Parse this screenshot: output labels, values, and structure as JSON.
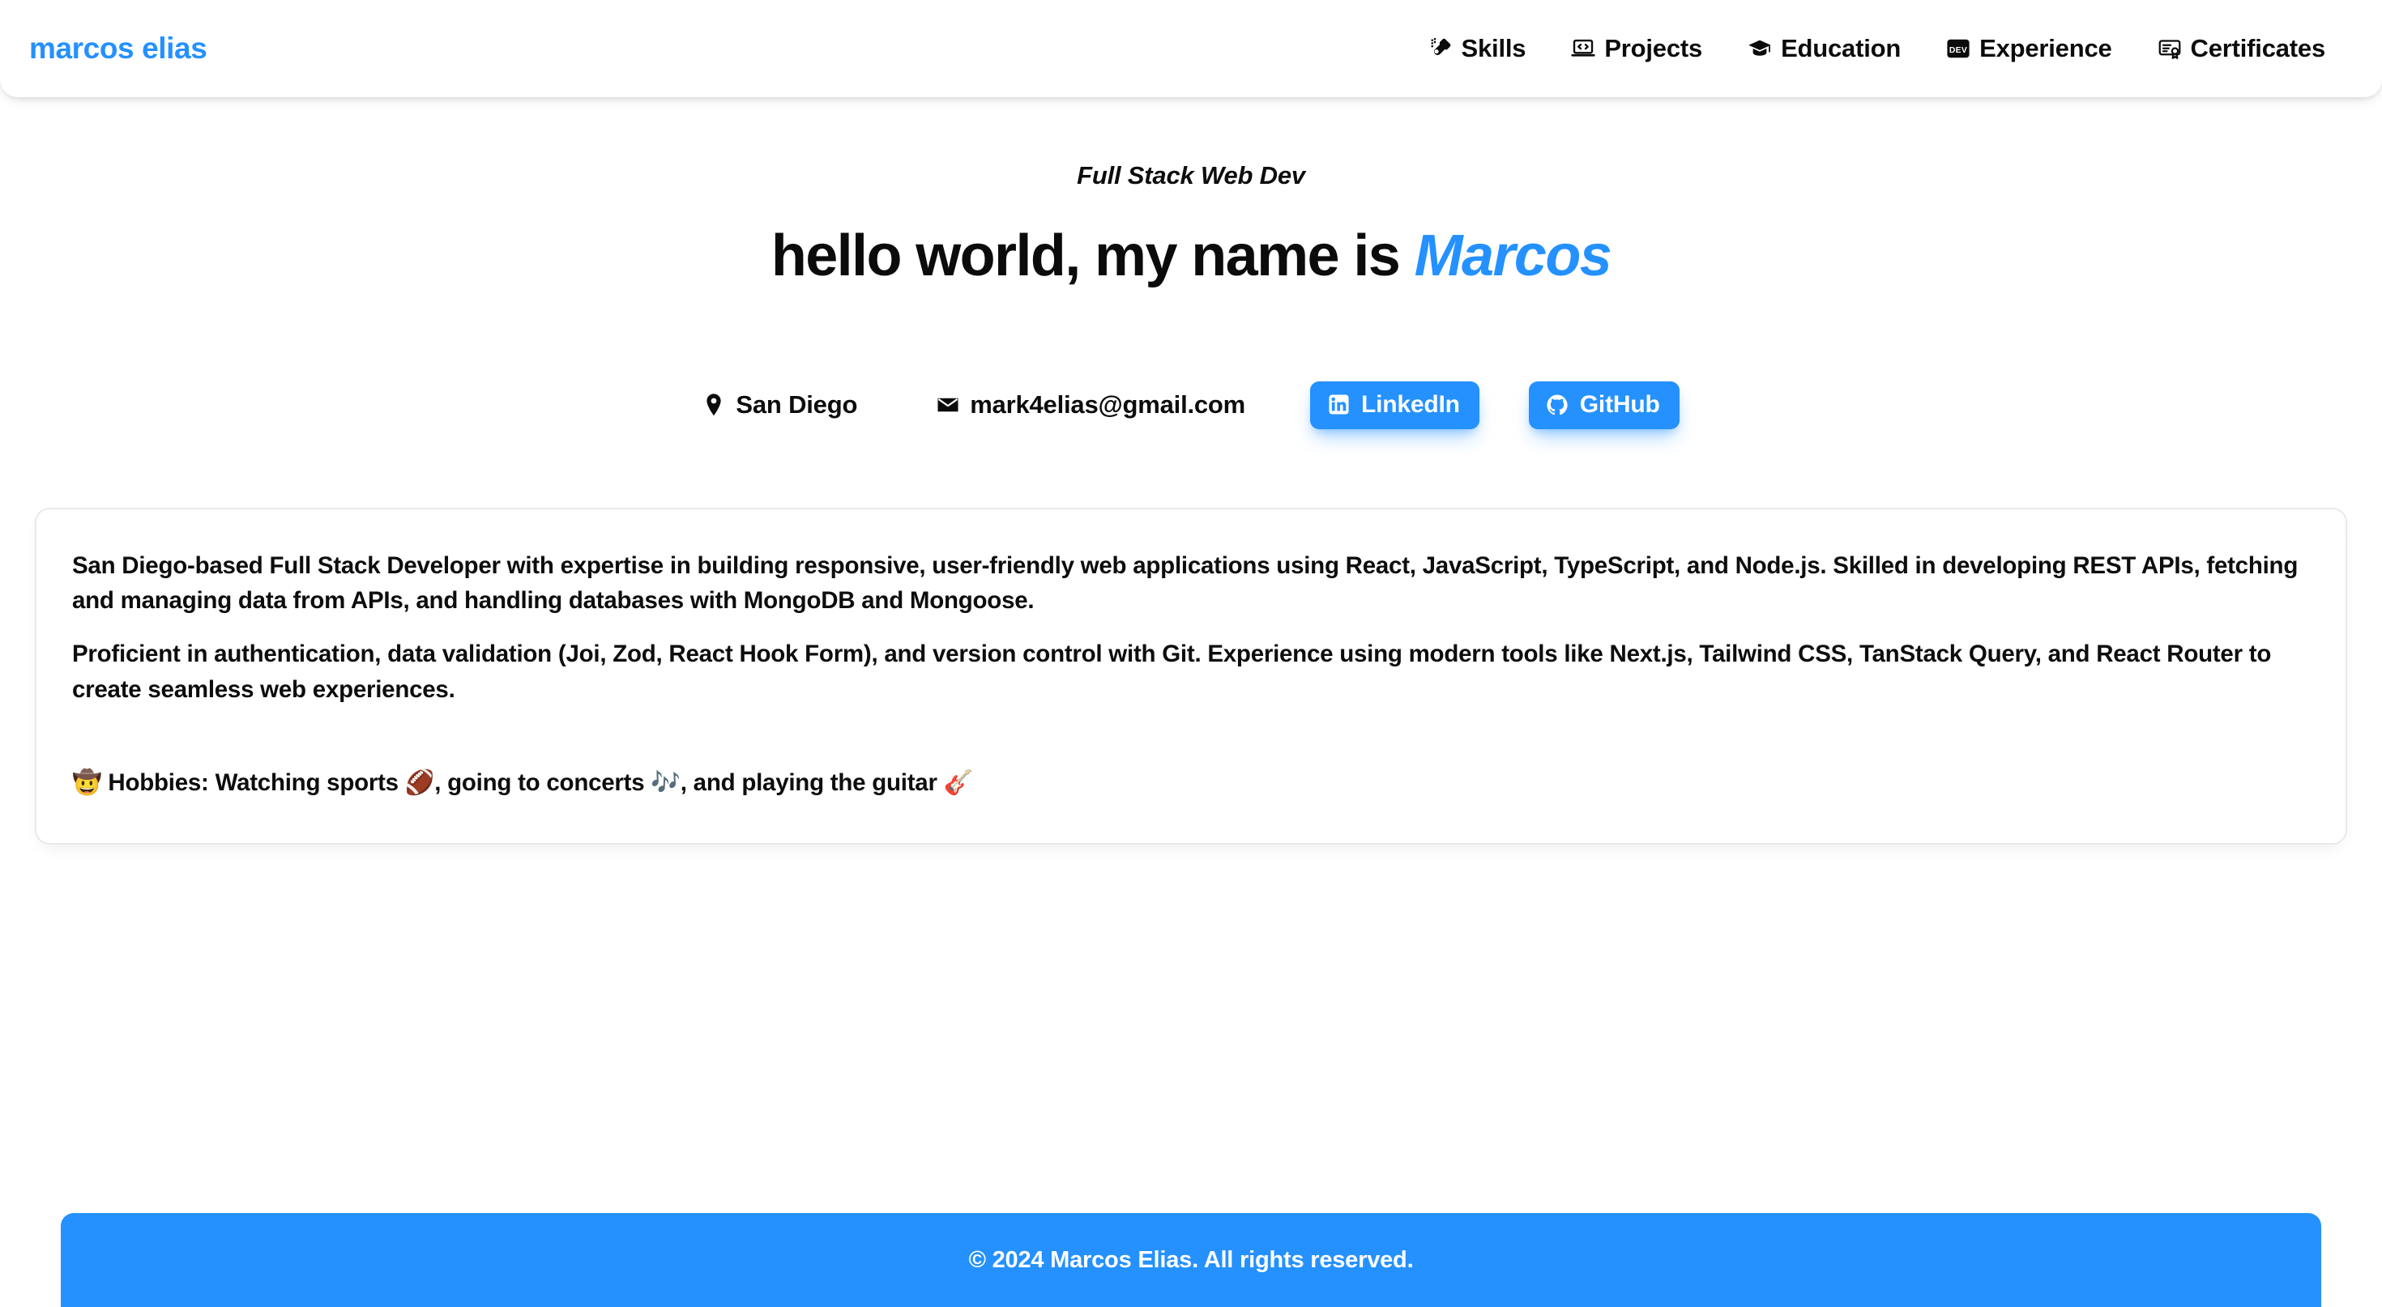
{
  "header": {
    "brand": "marcos elias",
    "nav": [
      {
        "label": "Skills",
        "icon": "guitar-icon"
      },
      {
        "label": "Projects",
        "icon": "code-laptop-icon"
      },
      {
        "label": "Education",
        "icon": "graduation-cap-icon"
      },
      {
        "label": "Experience",
        "icon": "dev-badge-icon"
      },
      {
        "label": "Certificates",
        "icon": "certificate-icon"
      }
    ]
  },
  "hero": {
    "tagline": "Full Stack Web Dev",
    "title_prefix": "hello world, my name is ",
    "title_accent": "Marcos"
  },
  "contact": {
    "location": {
      "text": "San Diego",
      "icon": "location-pin-icon"
    },
    "email": {
      "text": "mark4elias@gmail.com",
      "icon": "envelope-icon"
    },
    "socials": [
      {
        "label": "LinkedIn",
        "icon": "linkedin-icon"
      },
      {
        "label": "GitHub",
        "icon": "github-icon"
      }
    ]
  },
  "bio": {
    "paragraph1": "San Diego-based Full Stack Developer with expertise in building responsive, user-friendly web applications using React, JavaScript, TypeScript, and Node.js. Skilled in developing REST APIs, fetching and managing data from APIs, and handling databases with MongoDB and Mongoose.",
    "paragraph2": "Proficient in authentication, data validation (Joi, Zod, React Hook Form), and version control with Git. Experience using modern tools like Next.js, Tailwind CSS, TanStack Query, and React Router to create seamless web experiences.",
    "hobbies": "🤠 Hobbies: Watching sports 🏈, going to concerts 🎶, and playing the guitar 🎸"
  },
  "footer": {
    "copyright": "© 2024 Marcos Elias. All rights reserved."
  },
  "colors": {
    "accent": "#2491ff",
    "text": "#0d0d0d",
    "card_border": "#e9e9ec",
    "background": "#ffffff"
  }
}
